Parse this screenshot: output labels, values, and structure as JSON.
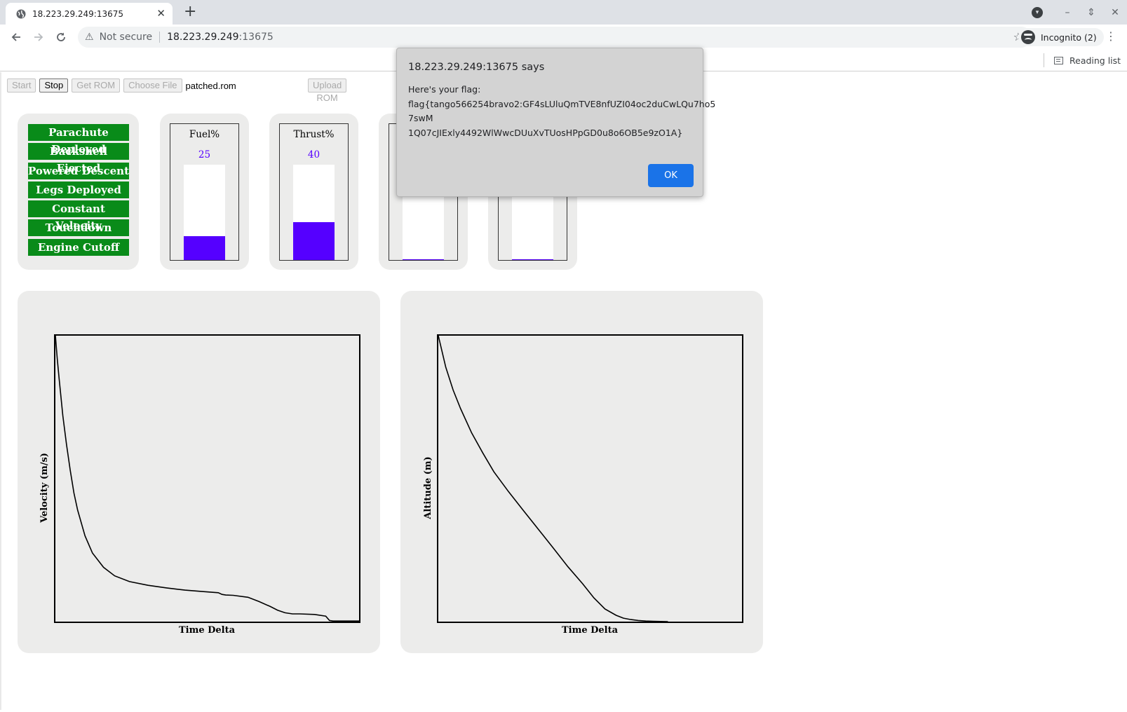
{
  "browser": {
    "tab_title": "18.223.29.249:13675",
    "url_security": "Not secure",
    "url_host": "18.223.29.249",
    "url_port": ":13675",
    "profile_label": "Incognito (2)",
    "reading_list": "Reading list"
  },
  "controls": {
    "start": "Start",
    "stop": "Stop",
    "get_rom": "Get ROM",
    "choose_file": "Choose File",
    "file_name": "patched.rom",
    "upload_rom": "Upload ROM"
  },
  "statuses": [
    "Parachute Deployed",
    "Backshell Ejected",
    "Powered Descent",
    "Legs Deployed",
    "Constant Velocity",
    "Touchdown",
    "Engine Cutoff"
  ],
  "status_color": "#098b19",
  "gauges": [
    {
      "label": "Fuel%",
      "value": "25",
      "level": 0.25
    },
    {
      "label": "Thrust%",
      "value": "40",
      "level": 0.4
    },
    {
      "label": "",
      "value": "",
      "level": 0.01
    },
    {
      "label": "",
      "value": "",
      "level": 0.01
    }
  ],
  "gauge_color": "#5500ff",
  "dialog": {
    "title": "18.223.29.249:13675 says",
    "line1": "Here's your flag:",
    "line2": "flag{tango566254bravo2:GF4sLUluQmTVE8nfUZI04oc2duCwLQu7ho5",
    "line3": "7swM",
    "line4": "1Q07cJIExly4492WlWwcDUuXvTUosHPpGD0u8o6OB5e9zO1A}",
    "ok": "OK"
  },
  "chart_data": [
    {
      "type": "line",
      "title": "",
      "xlabel": "Time Delta",
      "ylabel": "Velocity (m/s)",
      "x": [
        0,
        0.5,
        1,
        2,
        3,
        4,
        5,
        6,
        8,
        10,
        13,
        16,
        20,
        25,
        30,
        35,
        40,
        44,
        45,
        46,
        48,
        52,
        55,
        58,
        60,
        62,
        64,
        66,
        70,
        73,
        74,
        75,
        82
      ],
      "y": [
        100,
        92,
        85,
        72,
        62,
        53,
        45,
        39,
        30,
        24,
        19,
        16,
        14,
        12.7,
        11.8,
        11.0,
        10.5,
        10.1,
        9.5,
        9.3,
        9.2,
        8.5,
        7.0,
        5.3,
        4.0,
        3.1,
        2.7,
        2.7,
        2.5,
        1.9,
        0.4,
        0.2,
        0.2
      ],
      "xlim": [
        0,
        82
      ],
      "ylim": [
        0,
        100
      ],
      "grid": false
    },
    {
      "type": "line",
      "title": "",
      "xlabel": "Time Delta",
      "ylabel": "Altitude (m)",
      "x": [
        0,
        2,
        4,
        6,
        9,
        12,
        15,
        19,
        23,
        27,
        31,
        35,
        39,
        42,
        45,
        48,
        50,
        52,
        54,
        56,
        58,
        60,
        62
      ],
      "y": [
        100,
        89,
        81,
        74.5,
        66,
        59,
        52.4,
        45.4,
        38.8,
        32.3,
        25.8,
        19.2,
        13.2,
        8.3,
        4.4,
        2.2,
        1.2,
        0.7,
        0.4,
        0.2,
        0.1,
        0.05,
        0
      ],
      "xlim": [
        0,
        82
      ],
      "ylim": [
        0,
        100
      ],
      "grid": false
    }
  ]
}
